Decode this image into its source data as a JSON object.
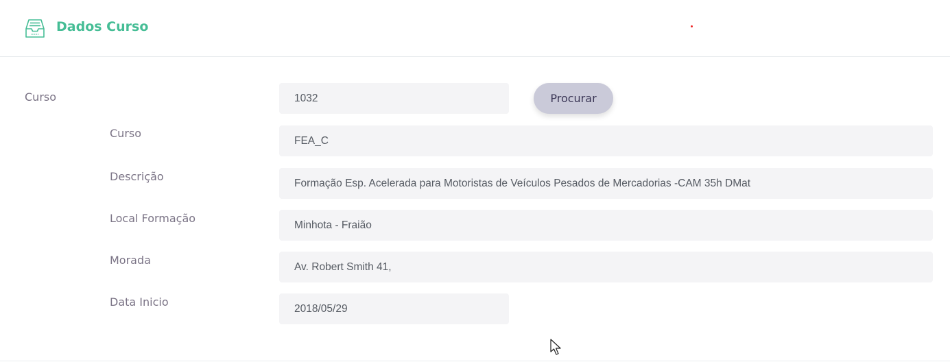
{
  "header": {
    "title": "Dados Curso",
    "icon": "inbox-tray-icon",
    "accent_color": "#45bd95"
  },
  "form": {
    "section_label": "Curso",
    "code_value": "1032",
    "search_button": "Procurar",
    "rows": [
      {
        "label": "Curso",
        "value": "FEA_C"
      },
      {
        "label": "Descrição",
        "value": "Formação Esp. Acelerada para Motoristas de Veículos Pesados de  Mercadorias -CAM 35h DMat"
      },
      {
        "label": "Local Formação",
        "value": "Minhota - Fraião"
      },
      {
        "label": "Morada",
        "value": "Av. Robert Smith 41,"
      },
      {
        "label": "Data Inicio",
        "value": "2018/05/29"
      }
    ]
  }
}
